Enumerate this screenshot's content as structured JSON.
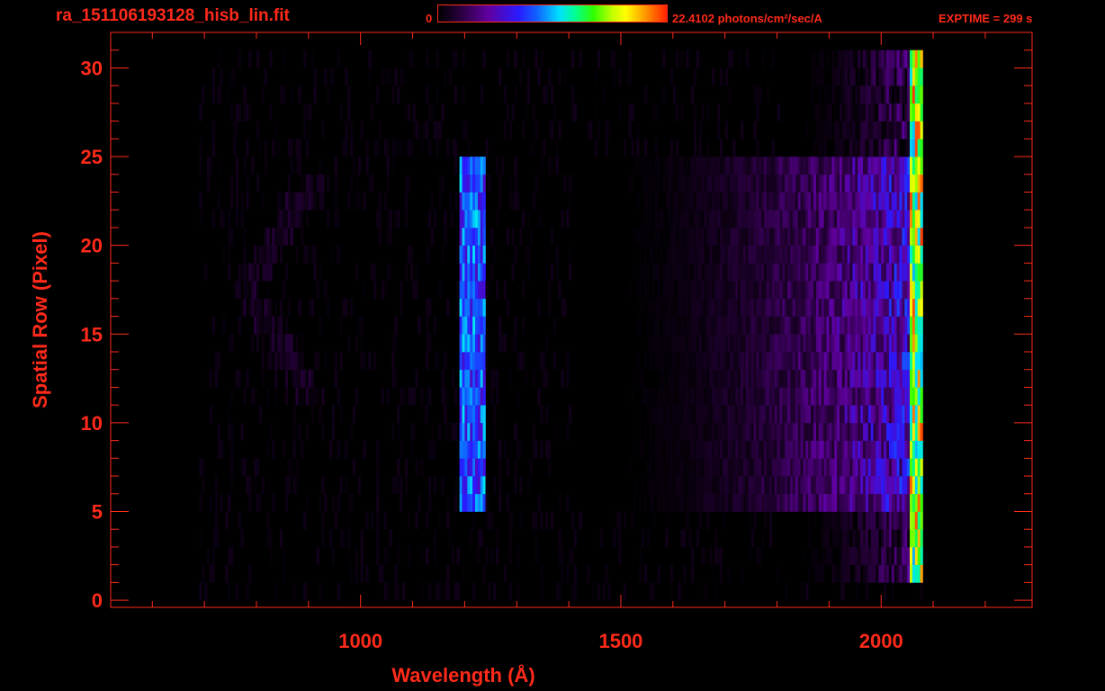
{
  "header": {
    "filename": "ra_151106193128_hisb_lin.fit",
    "colorbar_min_label": "0",
    "colorbar_max_label": "22.4102 photons/cm²/sec/A",
    "exptime_label": "EXPTIME = 299 s"
  },
  "colors": {
    "axis": "#ff2a1a",
    "background": "#000000"
  },
  "chart_data": {
    "type": "heatmap",
    "title": "ra_151106193128_hisb_lin.fit",
    "xlabel": "Wavelength (Å)",
    "ylabel": "Spatial Row (Pixel)",
    "xlim": [
      520,
      2290
    ],
    "ylim": [
      -0.4,
      32
    ],
    "x_ticks": [
      1000,
      1500,
      2000
    ],
    "x_tick_labels": [
      "1000",
      "1500",
      "2000"
    ],
    "y_ticks": [
      0,
      5,
      10,
      15,
      20,
      25,
      30
    ],
    "y_tick_labels": [
      "0",
      "5",
      "10",
      "15",
      "20",
      "25",
      "30"
    ],
    "colorbar": {
      "min": 0,
      "max": 22.4102,
      "unit": "photons/cm²/sec/A",
      "colormap": "rainbow"
    },
    "emission_features": [
      {
        "feature": "Lyman-alpha line",
        "wavelength_range": [
          1190,
          1235
        ],
        "rows": [
          5,
          24
        ],
        "peak_intensity": 11
      },
      {
        "feature": "red continuum",
        "wavelength_range": [
          1550,
          2060
        ],
        "rows": [
          5,
          24
        ],
        "peak_intensity": 8
      },
      {
        "feature": "detector edge",
        "wavelength_range": [
          2055,
          2075
        ],
        "rows": [
          1,
          30
        ],
        "peak_intensity": 22
      },
      {
        "feature": "faint arc",
        "wavelength_range": [
          780,
          900
        ],
        "rows": [
          11,
          23
        ],
        "peak_intensity": 2
      }
    ],
    "grid": false
  }
}
